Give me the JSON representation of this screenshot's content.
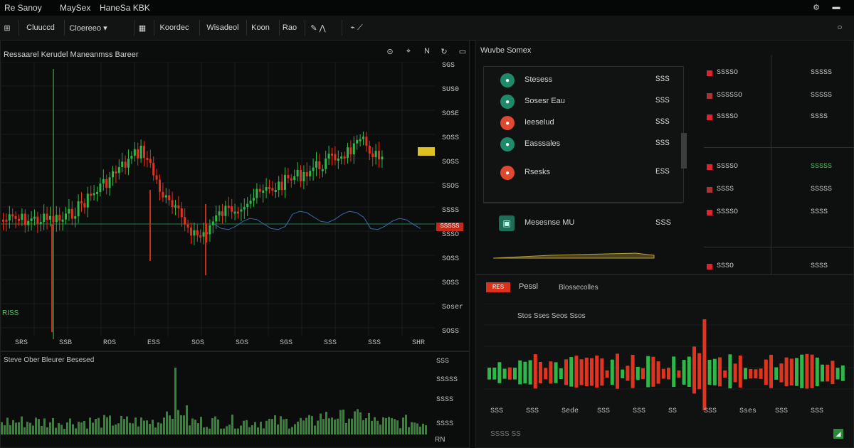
{
  "titlebar": {
    "title": "Re Sanoy",
    "menu1": "MaySex",
    "menu2": "HaneSa KBK"
  },
  "toolbar": {
    "tab1": "Cluuccd",
    "tab2": "Cloereeo ▾",
    "tab3": "Koordec",
    "tab4": "Wisadeol",
    "tab5": "Koon",
    "tab6": "Rao"
  },
  "main_chart": {
    "title": "Ressaarel Kerudel Maneanmss Bareer",
    "price_labels": [
      "SGS",
      "SUS0",
      "SOSE",
      "SOSS",
      "SOSS",
      "SSOS",
      "SSSS",
      "SSSO",
      "SOSS",
      "SOSS",
      "Soser",
      "SOSS"
    ],
    "last_price": "SSSSS",
    "left_label": "RISS",
    "x_labels": [
      "SRS",
      "SSB",
      "ROS",
      "ESS",
      "SOS",
      "SOS",
      "SGS",
      "SSS",
      "SSS",
      "SHR"
    ]
  },
  "volume": {
    "title": "Steve Ober Bleurer Besesed",
    "labels": [
      "SSS",
      "SSSSS",
      "SSSS",
      "SSSS"
    ],
    "bottom": "RN"
  },
  "watchlist": {
    "title": "Wuvbe Somex",
    "items": [
      {
        "name": "Stesess",
        "value": "SSS",
        "icon": "bell-icon",
        "color": "#1f8a6a"
      },
      {
        "name": "Sosesr Eau",
        "value": "SSS",
        "icon": "clock-icon",
        "color": "#1f8a6a"
      },
      {
        "name": "Ieeselud",
        "value": "SSS",
        "icon": "fire-icon",
        "color": "#e0492f"
      },
      {
        "name": "Easssales",
        "value": "SSS",
        "icon": "tongs-icon",
        "color": "#1f8a6a"
      },
      {
        "name": "Rsesks",
        "value": "ESS",
        "icon": "alert-icon",
        "color": "#e0492f"
      }
    ],
    "extra": {
      "name": "Mesesnse MU",
      "value": "SSS"
    }
  },
  "orderbook": {
    "left": [
      "SSSSO",
      "SSSSSO",
      "SSSSO",
      "SSSSO",
      "SSSS",
      "SSSSO",
      "SSSO"
    ],
    "right": [
      "SSSSS",
      "SSSSS",
      "SSSS",
      "SSSSS",
      "SSSSS",
      "SSSS",
      "SSSS"
    ]
  },
  "bottom_panel": {
    "badge": "RES",
    "title": "Pessl",
    "subtitle": "Blossecolles",
    "legend": "Stos Sses Seos Ssos",
    "x_labels": [
      "SSS",
      "SSS",
      "Sede",
      "SSS",
      "SSS",
      "SS",
      "SSS",
      "Sses",
      "SSS",
      "SSS"
    ],
    "footer": "SSSS SS"
  },
  "colors": {
    "up": "#2fb84a",
    "down": "#e2331f",
    "blue": "#3c5ea8",
    "bg": "#0a0b0b"
  }
}
